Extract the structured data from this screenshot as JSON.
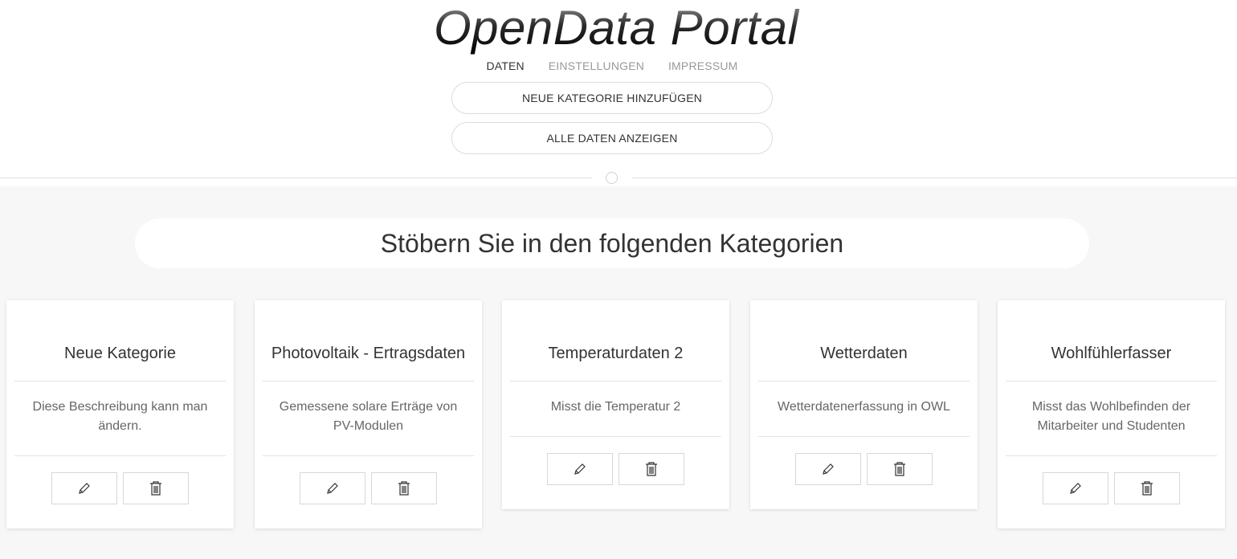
{
  "header": {
    "logo_text": "OpenData Portal",
    "nav": [
      {
        "label": "DATEN",
        "active": true
      },
      {
        "label": "EINSTELLUNGEN",
        "active": false
      },
      {
        "label": "IMPRESSUM",
        "active": false
      }
    ],
    "add_category_label": "NEUE KATEGORIE HINZUFÜGEN",
    "show_all_label": "ALLE DATEN ANZEIGEN"
  },
  "main": {
    "heading": "Stöbern Sie in den folgenden Kategorien",
    "cards": [
      {
        "title": "Neue Kategorie",
        "description": "Diese Beschreibung kann man ändern.",
        "edit_icon": "pencil-icon",
        "delete_icon": "trash-icon"
      },
      {
        "title": "Photovoltaik - Ertragsdaten",
        "description": "Gemessene solare Erträge von PV-Modulen",
        "edit_icon": "pencil-icon",
        "delete_icon": "trash-icon"
      },
      {
        "title": "Temperaturdaten 2",
        "description": "Misst die Temperatur 2",
        "edit_icon": "pencil-icon",
        "delete_icon": "trash-icon"
      },
      {
        "title": "Wetterdaten",
        "description": "Wetterdatenerfassung in OWL",
        "edit_icon": "pencil-icon",
        "delete_icon": "trash-icon"
      },
      {
        "title": "Wohlfühlerfasser",
        "description": "Misst das Wohlbefinden der Mitarbeiter und Studenten",
        "edit_icon": "pencil-icon",
        "delete_icon": "trash-icon"
      }
    ]
  }
}
